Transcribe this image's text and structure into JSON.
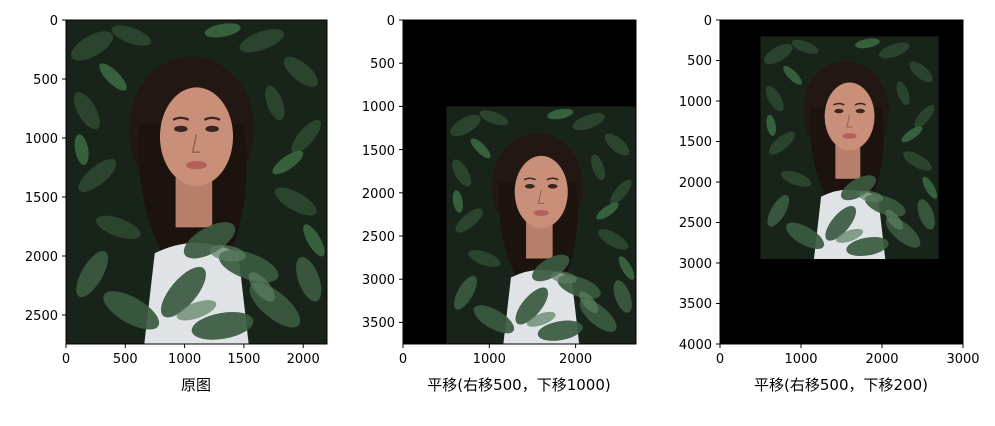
{
  "figure": {
    "panels": [
      {
        "id": "original",
        "xlabel": "原图",
        "xlim": [
          0,
          2200
        ],
        "ylim": [
          0,
          2750
        ],
        "xticks": [
          0,
          500,
          1000,
          1500,
          2000
        ],
        "yticks": [
          0,
          500,
          1000,
          1500,
          2000,
          2500
        ],
        "image_extent": {
          "x": [
            0,
            2200
          ],
          "y": [
            0,
            2750
          ]
        }
      },
      {
        "id": "shift-500-1000",
        "xlabel": "平移(右移500，下移1000)",
        "xlim": [
          0,
          2700
        ],
        "ylim": [
          0,
          3750
        ],
        "xticks": [
          0,
          1000,
          2000
        ],
        "yticks": [
          0,
          500,
          1000,
          1500,
          2000,
          2500,
          3000,
          3500
        ],
        "image_extent": {
          "x": [
            500,
            2700
          ],
          "y": [
            1000,
            3750
          ]
        }
      },
      {
        "id": "shift-500-200",
        "xlabel": "平移(右移500，下移200)",
        "xlim": [
          0,
          3000
        ],
        "ylim": [
          0,
          4000
        ],
        "xticks": [
          0,
          1000,
          2000,
          3000
        ],
        "yticks": [
          0,
          500,
          1000,
          1500,
          2000,
          2500,
          3000,
          3500,
          4000
        ],
        "image_extent": {
          "x": [
            500,
            2700
          ],
          "y": [
            200,
            2950
          ]
        }
      }
    ],
    "background_color": "#000000",
    "photo_colors": {
      "foliage_dark": "#1c2a1e",
      "foliage_light": "#3f6a45",
      "skin": "#c98f78",
      "hair": "#231813",
      "shirt": "#e6e8ea"
    }
  }
}
